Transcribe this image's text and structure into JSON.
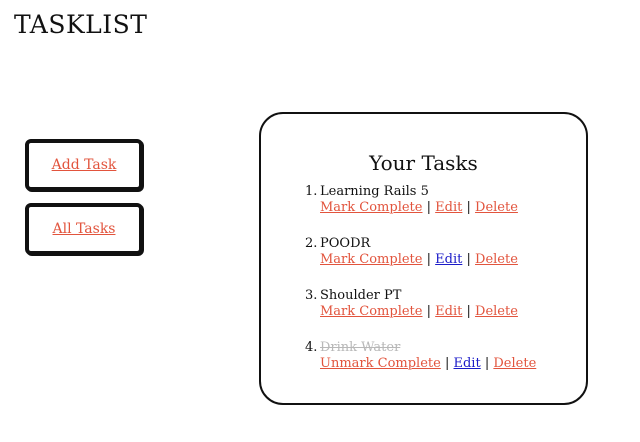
{
  "app": {
    "title": "TASKLIST"
  },
  "nav": {
    "add_task_label": "Add Task",
    "all_tasks_label": "All Tasks"
  },
  "panel": {
    "title": "Your Tasks"
  },
  "separator": "|",
  "colors": {
    "link": "#e2543d",
    "visited_link": "#1a1ac8",
    "completed_text": "#b8b8b8",
    "border": "#111111"
  },
  "tasks": [
    {
      "number": "1.",
      "name": "Learning Rails 5",
      "completed": false,
      "toggle_label": "Mark Complete",
      "edit_label": "Edit",
      "delete_label": "Delete"
    },
    {
      "number": "2.",
      "name": "POODR",
      "completed": false,
      "toggle_label": "Mark Complete",
      "edit_label": "Edit",
      "delete_label": "Delete"
    },
    {
      "number": "3.",
      "name": "Shoulder PT",
      "completed": false,
      "toggle_label": "Mark Complete",
      "edit_label": "Edit",
      "delete_label": "Delete"
    },
    {
      "number": "4.",
      "name": "Drink Water",
      "completed": true,
      "toggle_label": "Unmark Complete",
      "edit_label": "Edit",
      "delete_label": "Delete"
    }
  ]
}
